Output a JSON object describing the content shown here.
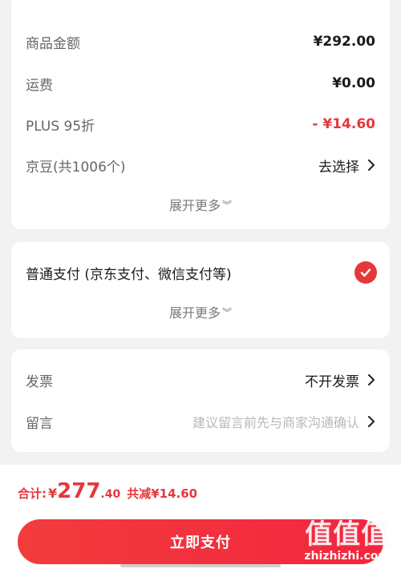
{
  "summary": {
    "rows": [
      {
        "label": "商品金额",
        "value": "¥292.00"
      },
      {
        "label": "运费",
        "value": "¥0.00"
      },
      {
        "label": "PLUS 95折",
        "value": "- ¥14.60"
      },
      {
        "label": "京豆(共1006个)",
        "value": "去选择"
      }
    ],
    "expand_more": "展开更多"
  },
  "payment": {
    "method_label": "普通支付 (京东支付、微信支付等)",
    "expand_more": "展开更多",
    "selected": true
  },
  "extras": {
    "invoice_label": "发票",
    "invoice_value": "不开发票",
    "message_label": "留言",
    "message_placeholder": "建议留言前先与商家沟通确认"
  },
  "footer": {
    "total_label": "合计:",
    "currency": "¥",
    "amount_int": "277",
    "amount_dec": ".40",
    "saved": "共减¥14.60",
    "pay_button": "立即支付"
  },
  "watermark": {
    "logo": "值值值",
    "domain": "zhizhizhi.com"
  },
  "colors": {
    "accent": "#e4393c",
    "label_gray": "#666666",
    "hint_gray": "#b8b8b8",
    "background": "#f2f2f2"
  },
  "icons": [
    "chevron-right-icon",
    "chevron-down-icon",
    "checkmark-icon"
  ]
}
